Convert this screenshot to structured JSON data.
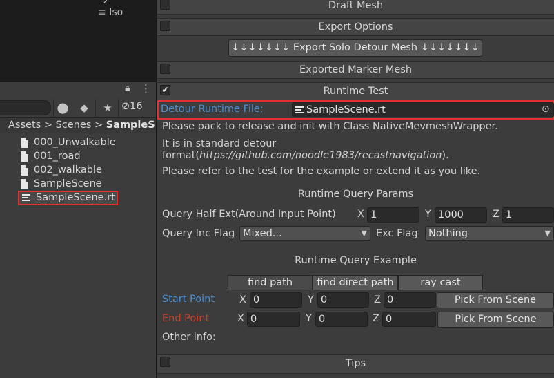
{
  "scene": {
    "gizmo_axis": "z",
    "projection_label": "Iso"
  },
  "project": {
    "hidden_count": "16",
    "breadcrumb": [
      "Assets",
      "Scenes",
      "SampleS"
    ],
    "files": [
      "000_Unwalkable",
      "001_road",
      "002_walkable",
      "SampleScene"
    ],
    "selected_file": "SampleScene.rt"
  },
  "inspector": {
    "draft_mesh": "Draft Mesh",
    "export_options": "Export Options",
    "export_solo_button": "↓↓↓↓↓↓↓ Export Solo Detour Mesh ↓↓↓↓↓↓↓",
    "exported_marker": "Exported Marker Mesh",
    "runtime_test": "Runtime Test",
    "runtime_test_checked": "✔",
    "runtime_file_label": "Detour Runtime File:",
    "runtime_file_value": "SampleScene.rt",
    "info1": "Please pack to release and init with Class NativeMevmeshWrapper.",
    "info2a": "It is in standard detour",
    "info2b_prefix": "format(",
    "info2b_link": "https://github.com/noodle1983/recastnavigation",
    "info2b_suffix": ").",
    "info3": "Please refer to the test for the example or extend it as you like.",
    "query_params_title": "Runtime Query Params",
    "half_ext_label": "Query Half Ext(Around Input Point)",
    "half_ext": {
      "x": "1",
      "y": "1000",
      "z": "1"
    },
    "inc_flag_label": "Query Inc Flag",
    "inc_flag_value": "Mixed...",
    "exc_flag_label": "Exc Flag",
    "exc_flag_value": "Nothing",
    "query_example_title": "Runtime Query Example",
    "tabs": [
      "find path",
      "find direct path",
      "ray cast"
    ],
    "start_point_label": "Start Point",
    "start_point": {
      "x": "0",
      "y": "0",
      "z": "0"
    },
    "end_point_label": "End Point",
    "end_point": {
      "x": "0",
      "y": "0",
      "z": "0"
    },
    "pick_button": "Pick From Scene",
    "other_info": "Other info:",
    "tips": "Tips",
    "axis_x": "X",
    "axis_y": "Y",
    "axis_z": "Z"
  },
  "colors": {
    "link_blue": "#4a8fd4",
    "end_red": "#c8402a",
    "highlight_red": "#e03030"
  }
}
